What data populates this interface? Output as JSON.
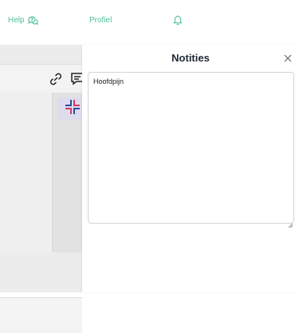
{
  "nav": {
    "help_label": "Help",
    "profile_label": "Profiel",
    "accent_color": "#4fbf9a",
    "help_icon": "chat-question-icon",
    "notifications_icon": "bell-icon"
  },
  "background_app": {
    "toolbar_icons": [
      "link-icon",
      "comment-icon"
    ],
    "collapse_icon": "collapse-arrows-icon"
  },
  "notes_panel": {
    "title": "Notities",
    "close_icon": "close-icon",
    "note_text": "Hoofdpijn"
  }
}
